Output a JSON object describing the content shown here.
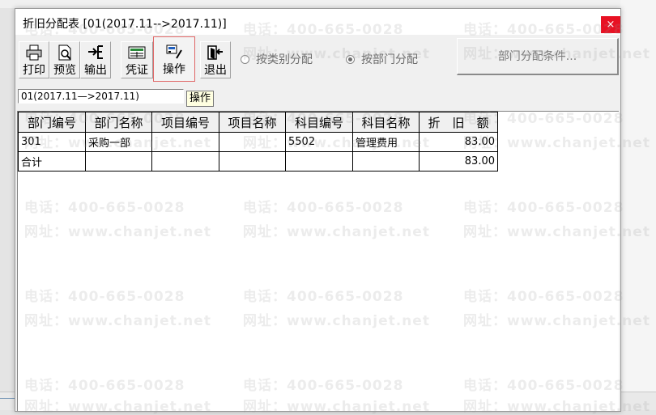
{
  "window": {
    "title": "折旧分配表 [01(2017.11-->2017.11)]",
    "close_glyph": "×"
  },
  "toolbar": {
    "buttons": [
      {
        "label": "打印",
        "icon": "printer-icon"
      },
      {
        "label": "预览",
        "icon": "preview-icon"
      },
      {
        "label": "输出",
        "icon": "export-icon"
      },
      {
        "label": "凭证",
        "icon": "voucher-icon"
      },
      {
        "label": "操作",
        "icon": "operate-icon"
      },
      {
        "label": "退出",
        "icon": "exit-icon"
      }
    ],
    "tooltip": "操作"
  },
  "options": {
    "by_category": {
      "label": "按类别分配",
      "selected": false
    },
    "by_department": {
      "label": "按部门分配",
      "selected": true
    },
    "condition_button": "部门分配条件..."
  },
  "period": {
    "value": "01(2017.11—>2017.11)"
  },
  "table": {
    "headers": [
      "部门编号",
      "部门名称",
      "项目编号",
      "项目名称",
      "科目编号",
      "科目名称",
      "折　旧　额"
    ],
    "rows": [
      [
        "301",
        "采购一部",
        "",
        "",
        "5502",
        "管理费用",
        "83.00"
      ],
      [
        "合计",
        "",
        "",
        "",
        "",
        "",
        "83.00"
      ]
    ]
  },
  "watermark": {
    "phone": "电话：400-665-0028",
    "site": "网址：www.chanjet.net"
  }
}
